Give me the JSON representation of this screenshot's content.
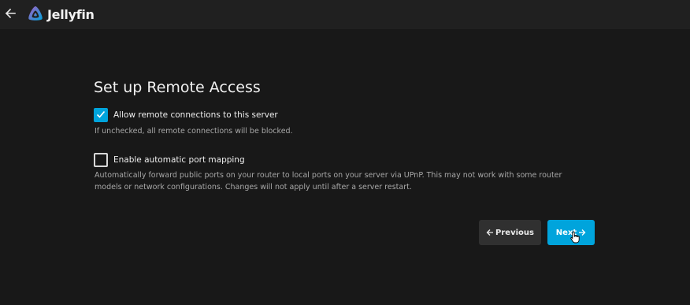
{
  "header": {
    "back_icon": "arrow-left-icon",
    "logo_icon": "jellyfin-logo-icon",
    "app_name": "Jellyfin"
  },
  "page": {
    "title": "Set up Remote Access"
  },
  "remote_access": {
    "label": "Allow remote connections to this server",
    "checked": true,
    "help": "If unchecked, all remote connections will be blocked."
  },
  "port_mapping": {
    "label": "Enable automatic port mapping",
    "checked": false,
    "help_line1": "Automatically forward public ports on your router to local ports on your server via UPnP. This may not work with some router",
    "help_line2": "models or network configurations. Changes will not apply until after a server restart."
  },
  "buttons": {
    "previous_label": "Previous",
    "next_label": "Next"
  },
  "colors": {
    "accent": "#00a4dc",
    "background": "#181818",
    "header": "#202020",
    "secondary_button": "#303030"
  }
}
